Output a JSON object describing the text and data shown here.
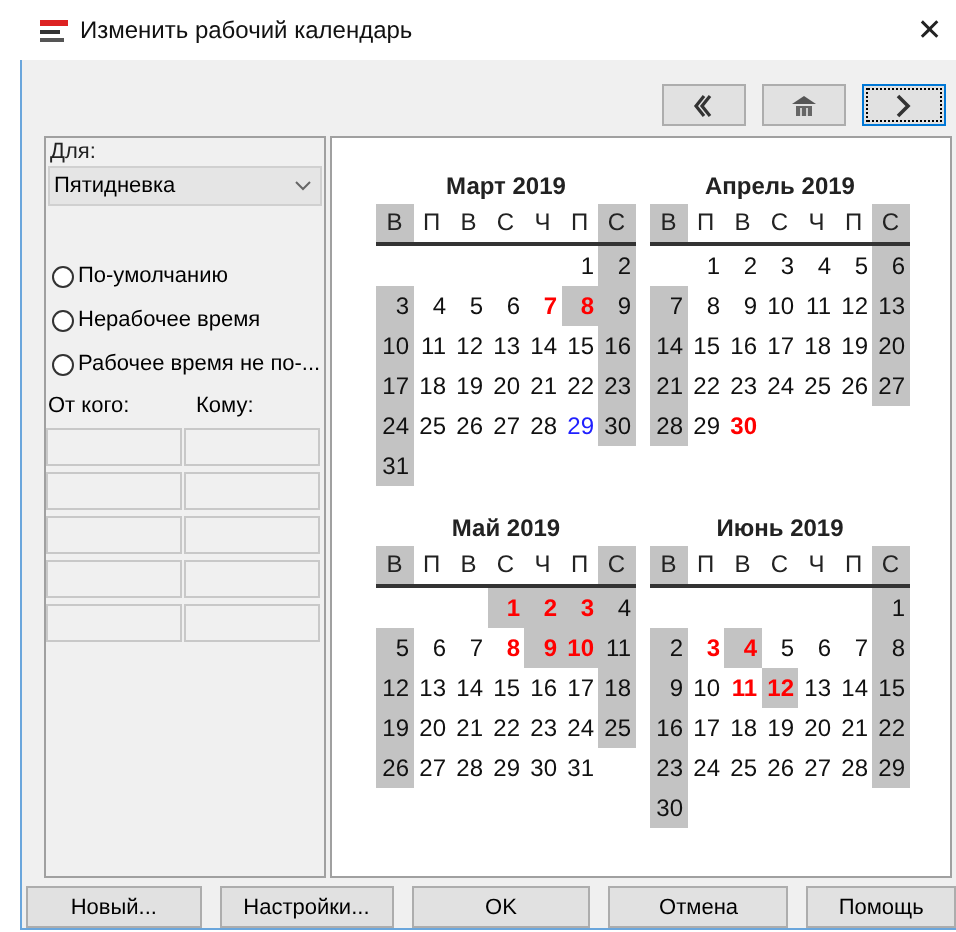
{
  "window": {
    "title": "Изменить рабочий календарь",
    "close": "✕"
  },
  "nav_buttons": [
    {
      "kind": "prev",
      "focused": false
    },
    {
      "kind": "home",
      "focused": false
    },
    {
      "kind": "next",
      "focused": true
    }
  ],
  "left_panel": {
    "for_label": "Для:",
    "calendar_select": {
      "value": "Пятидневка"
    },
    "options": [
      {
        "label": "По-умолчанию",
        "selected": false
      },
      {
        "label": "Нерабочее время",
        "selected": false
      },
      {
        "label": "Рабочее время не по-...",
        "selected": false
      }
    ],
    "period_columns": [
      "От кого:",
      "Кому:"
    ]
  },
  "months": [
    {
      "title": "Март 2019",
      "weekdays": [
        {
          "label": "В",
          "nonworking": true
        },
        {
          "label": "П",
          "nonworking": false
        },
        {
          "label": "В",
          "nonworking": false
        },
        {
          "label": "С",
          "nonworking": false
        },
        {
          "label": "Ч",
          "nonworking": false
        },
        {
          "label": "П",
          "nonworking": false
        },
        {
          "label": "С",
          "nonworking": true
        }
      ],
      "weeks": [
        [
          {
            "day": "1",
            "nonworking": false,
            "kind": "plain"
          },
          {
            "day": "2",
            "nonworking": true,
            "kind": "plain"
          }
        ],
        [
          {
            "day": "3",
            "nonworking": true,
            "kind": "plain"
          },
          {
            "day": "4",
            "nonworking": false,
            "kind": "plain"
          },
          {
            "day": "5",
            "nonworking": false,
            "kind": "plain"
          },
          {
            "day": "6",
            "nonworking": false,
            "kind": "plain"
          },
          {
            "day": "7",
            "nonworking": false,
            "kind": "exception"
          },
          {
            "day": "8",
            "nonworking": true,
            "kind": "exception"
          },
          {
            "day": "9",
            "nonworking": true,
            "kind": "plain"
          }
        ],
        [
          {
            "day": "10",
            "nonworking": true,
            "kind": "plain"
          },
          {
            "day": "11",
            "nonworking": false,
            "kind": "plain"
          },
          {
            "day": "12",
            "nonworking": false,
            "kind": "plain"
          },
          {
            "day": "13",
            "nonworking": false,
            "kind": "plain"
          },
          {
            "day": "14",
            "nonworking": false,
            "kind": "plain"
          },
          {
            "day": "15",
            "nonworking": false,
            "kind": "plain"
          },
          {
            "day": "16",
            "nonworking": true,
            "kind": "plain"
          }
        ],
        [
          {
            "day": "17",
            "nonworking": true,
            "kind": "plain"
          },
          {
            "day": "18",
            "nonworking": false,
            "kind": "plain"
          },
          {
            "day": "19",
            "nonworking": false,
            "kind": "plain"
          },
          {
            "day": "20",
            "nonworking": false,
            "kind": "plain"
          },
          {
            "day": "21",
            "nonworking": false,
            "kind": "plain"
          },
          {
            "day": "22",
            "nonworking": false,
            "kind": "plain"
          },
          {
            "day": "23",
            "nonworking": true,
            "kind": "plain"
          }
        ],
        [
          {
            "day": "24",
            "nonworking": true,
            "kind": "plain"
          },
          {
            "day": "25",
            "nonworking": false,
            "kind": "plain"
          },
          {
            "day": "26",
            "nonworking": false,
            "kind": "plain"
          },
          {
            "day": "27",
            "nonworking": false,
            "kind": "plain"
          },
          {
            "day": "28",
            "nonworking": false,
            "kind": "plain"
          },
          {
            "day": "29",
            "nonworking": false,
            "kind": "today"
          },
          {
            "day": "30",
            "nonworking": true,
            "kind": "plain"
          }
        ],
        [
          {
            "day": "31",
            "nonworking": true,
            "kind": "plain"
          }
        ]
      ]
    },
    {
      "title": "Апрель 2019",
      "weekdays": [
        {
          "label": "В",
          "nonworking": true
        },
        {
          "label": "П",
          "nonworking": false
        },
        {
          "label": "В",
          "nonworking": false
        },
        {
          "label": "С",
          "nonworking": false
        },
        {
          "label": "Ч",
          "nonworking": false
        },
        {
          "label": "П",
          "nonworking": false
        },
        {
          "label": "С",
          "nonworking": true
        }
      ],
      "weeks": [
        [
          {
            "day": "1",
            "nonworking": false,
            "kind": "plain"
          },
          {
            "day": "2",
            "nonworking": false,
            "kind": "plain"
          },
          {
            "day": "3",
            "nonworking": false,
            "kind": "plain"
          },
          {
            "day": "4",
            "nonworking": false,
            "kind": "plain"
          },
          {
            "day": "5",
            "nonworking": false,
            "kind": "plain"
          },
          {
            "day": "6",
            "nonworking": true,
            "kind": "plain"
          }
        ],
        [
          {
            "day": "7",
            "nonworking": true,
            "kind": "plain"
          },
          {
            "day": "8",
            "nonworking": false,
            "kind": "plain"
          },
          {
            "day": "9",
            "nonworking": false,
            "kind": "plain"
          },
          {
            "day": "10",
            "nonworking": false,
            "kind": "plain"
          },
          {
            "day": "11",
            "nonworking": false,
            "kind": "plain"
          },
          {
            "day": "12",
            "nonworking": false,
            "kind": "plain"
          },
          {
            "day": "13",
            "nonworking": true,
            "kind": "plain"
          }
        ],
        [
          {
            "day": "14",
            "nonworking": true,
            "kind": "plain"
          },
          {
            "day": "15",
            "nonworking": false,
            "kind": "plain"
          },
          {
            "day": "16",
            "nonworking": false,
            "kind": "plain"
          },
          {
            "day": "17",
            "nonworking": false,
            "kind": "plain"
          },
          {
            "day": "18",
            "nonworking": false,
            "kind": "plain"
          },
          {
            "day": "19",
            "nonworking": false,
            "kind": "plain"
          },
          {
            "day": "20",
            "nonworking": true,
            "kind": "plain"
          }
        ],
        [
          {
            "day": "21",
            "nonworking": true,
            "kind": "plain"
          },
          {
            "day": "22",
            "nonworking": false,
            "kind": "plain"
          },
          {
            "day": "23",
            "nonworking": false,
            "kind": "plain"
          },
          {
            "day": "24",
            "nonworking": false,
            "kind": "plain"
          },
          {
            "day": "25",
            "nonworking": false,
            "kind": "plain"
          },
          {
            "day": "26",
            "nonworking": false,
            "kind": "plain"
          },
          {
            "day": "27",
            "nonworking": true,
            "kind": "plain"
          }
        ],
        [
          {
            "day": "28",
            "nonworking": true,
            "kind": "plain"
          },
          {
            "day": "29",
            "nonworking": false,
            "kind": "plain"
          },
          {
            "day": "30",
            "nonworking": false,
            "kind": "exception"
          }
        ]
      ]
    },
    {
      "title": "Май 2019",
      "weekdays": [
        {
          "label": "В",
          "nonworking": true
        },
        {
          "label": "П",
          "nonworking": false
        },
        {
          "label": "В",
          "nonworking": false
        },
        {
          "label": "С",
          "nonworking": false
        },
        {
          "label": "Ч",
          "nonworking": false
        },
        {
          "label": "П",
          "nonworking": false
        },
        {
          "label": "С",
          "nonworking": true
        }
      ],
      "weeks": [
        [
          {
            "day": "1",
            "nonworking": true,
            "kind": "exception"
          },
          {
            "day": "2",
            "nonworking": true,
            "kind": "exception"
          },
          {
            "day": "3",
            "nonworking": true,
            "kind": "exception"
          },
          {
            "day": "4",
            "nonworking": true,
            "kind": "plain"
          }
        ],
        [
          {
            "day": "5",
            "nonworking": true,
            "kind": "plain"
          },
          {
            "day": "6",
            "nonworking": false,
            "kind": "plain"
          },
          {
            "day": "7",
            "nonworking": false,
            "kind": "plain"
          },
          {
            "day": "8",
            "nonworking": false,
            "kind": "exception"
          },
          {
            "day": "9",
            "nonworking": true,
            "kind": "exception"
          },
          {
            "day": "10",
            "nonworking": true,
            "kind": "exception"
          },
          {
            "day": "11",
            "nonworking": true,
            "kind": "plain"
          }
        ],
        [
          {
            "day": "12",
            "nonworking": true,
            "kind": "plain"
          },
          {
            "day": "13",
            "nonworking": false,
            "kind": "plain"
          },
          {
            "day": "14",
            "nonworking": false,
            "kind": "plain"
          },
          {
            "day": "15",
            "nonworking": false,
            "kind": "plain"
          },
          {
            "day": "16",
            "nonworking": false,
            "kind": "plain"
          },
          {
            "day": "17",
            "nonworking": false,
            "kind": "plain"
          },
          {
            "day": "18",
            "nonworking": true,
            "kind": "plain"
          }
        ],
        [
          {
            "day": "19",
            "nonworking": true,
            "kind": "plain"
          },
          {
            "day": "20",
            "nonworking": false,
            "kind": "plain"
          },
          {
            "day": "21",
            "nonworking": false,
            "kind": "plain"
          },
          {
            "day": "22",
            "nonworking": false,
            "kind": "plain"
          },
          {
            "day": "23",
            "nonworking": false,
            "kind": "plain"
          },
          {
            "day": "24",
            "nonworking": false,
            "kind": "plain"
          },
          {
            "day": "25",
            "nonworking": true,
            "kind": "plain"
          }
        ],
        [
          {
            "day": "26",
            "nonworking": true,
            "kind": "plain"
          },
          {
            "day": "27",
            "nonworking": false,
            "kind": "plain"
          },
          {
            "day": "28",
            "nonworking": false,
            "kind": "plain"
          },
          {
            "day": "29",
            "nonworking": false,
            "kind": "plain"
          },
          {
            "day": "30",
            "nonworking": false,
            "kind": "plain"
          },
          {
            "day": "31",
            "nonworking": false,
            "kind": "plain"
          }
        ]
      ]
    },
    {
      "title": "Июнь 2019",
      "weekdays": [
        {
          "label": "В",
          "nonworking": true
        },
        {
          "label": "П",
          "nonworking": false
        },
        {
          "label": "В",
          "nonworking": false
        },
        {
          "label": "С",
          "nonworking": false
        },
        {
          "label": "Ч",
          "nonworking": false
        },
        {
          "label": "П",
          "nonworking": false
        },
        {
          "label": "С",
          "nonworking": true
        }
      ],
      "weeks": [
        [
          {
            "day": "1",
            "nonworking": true,
            "kind": "plain"
          }
        ],
        [
          {
            "day": "2",
            "nonworking": true,
            "kind": "plain"
          },
          {
            "day": "3",
            "nonworking": false,
            "kind": "exception"
          },
          {
            "day": "4",
            "nonworking": true,
            "kind": "exception"
          },
          {
            "day": "5",
            "nonworking": false,
            "kind": "plain"
          },
          {
            "day": "6",
            "nonworking": false,
            "kind": "plain"
          },
          {
            "day": "7",
            "nonworking": false,
            "kind": "plain"
          },
          {
            "day": "8",
            "nonworking": true,
            "kind": "plain"
          }
        ],
        [
          {
            "day": "9",
            "nonworking": true,
            "kind": "plain"
          },
          {
            "day": "10",
            "nonworking": false,
            "kind": "plain"
          },
          {
            "day": "11",
            "nonworking": false,
            "kind": "exception"
          },
          {
            "day": "12",
            "nonworking": true,
            "kind": "exception"
          },
          {
            "day": "13",
            "nonworking": false,
            "kind": "plain"
          },
          {
            "day": "14",
            "nonworking": false,
            "kind": "plain"
          },
          {
            "day": "15",
            "nonworking": true,
            "kind": "plain"
          }
        ],
        [
          {
            "day": "16",
            "nonworking": true,
            "kind": "plain"
          },
          {
            "day": "17",
            "nonworking": false,
            "kind": "plain"
          },
          {
            "day": "18",
            "nonworking": false,
            "kind": "plain"
          },
          {
            "day": "19",
            "nonworking": false,
            "kind": "plain"
          },
          {
            "day": "20",
            "nonworking": false,
            "kind": "plain"
          },
          {
            "day": "21",
            "nonworking": false,
            "kind": "plain"
          },
          {
            "day": "22",
            "nonworking": true,
            "kind": "plain"
          }
        ],
        [
          {
            "day": "23",
            "nonworking": true,
            "kind": "plain"
          },
          {
            "day": "24",
            "nonworking": false,
            "kind": "plain"
          },
          {
            "day": "25",
            "nonworking": false,
            "kind": "plain"
          },
          {
            "day": "26",
            "nonworking": false,
            "kind": "plain"
          },
          {
            "day": "27",
            "nonworking": false,
            "kind": "plain"
          },
          {
            "day": "28",
            "nonworking": false,
            "kind": "plain"
          },
          {
            "day": "29",
            "nonworking": true,
            "kind": "plain"
          }
        ],
        [
          {
            "day": "30",
            "nonworking": true,
            "kind": "plain"
          }
        ]
      ]
    }
  ],
  "buttons": [
    "Новый...",
    "Настройки...",
    "OK",
    "Отмена",
    "Помощь"
  ]
}
